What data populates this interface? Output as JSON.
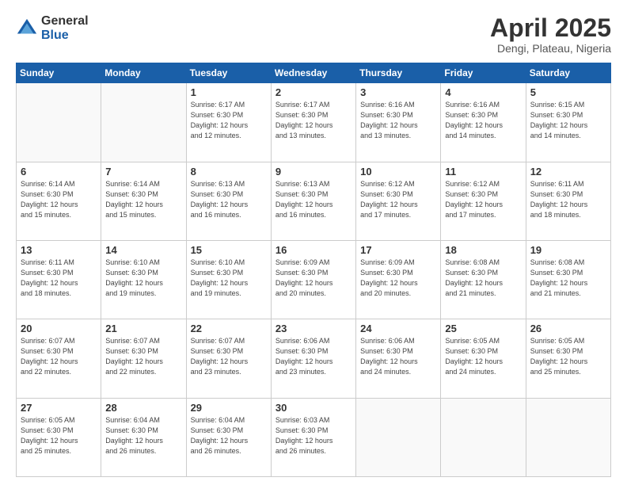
{
  "logo": {
    "general": "General",
    "blue": "Blue"
  },
  "title": {
    "month": "April 2025",
    "location": "Dengi, Plateau, Nigeria"
  },
  "weekdays": [
    "Sunday",
    "Monday",
    "Tuesday",
    "Wednesday",
    "Thursday",
    "Friday",
    "Saturday"
  ],
  "days": [
    {
      "date": "",
      "info": ""
    },
    {
      "date": "",
      "info": ""
    },
    {
      "date": "1",
      "info": "Sunrise: 6:17 AM\nSunset: 6:30 PM\nDaylight: 12 hours\nand 12 minutes."
    },
    {
      "date": "2",
      "info": "Sunrise: 6:17 AM\nSunset: 6:30 PM\nDaylight: 12 hours\nand 13 minutes."
    },
    {
      "date": "3",
      "info": "Sunrise: 6:16 AM\nSunset: 6:30 PM\nDaylight: 12 hours\nand 13 minutes."
    },
    {
      "date": "4",
      "info": "Sunrise: 6:16 AM\nSunset: 6:30 PM\nDaylight: 12 hours\nand 14 minutes."
    },
    {
      "date": "5",
      "info": "Sunrise: 6:15 AM\nSunset: 6:30 PM\nDaylight: 12 hours\nand 14 minutes."
    },
    {
      "date": "6",
      "info": "Sunrise: 6:14 AM\nSunset: 6:30 PM\nDaylight: 12 hours\nand 15 minutes."
    },
    {
      "date": "7",
      "info": "Sunrise: 6:14 AM\nSunset: 6:30 PM\nDaylight: 12 hours\nand 15 minutes."
    },
    {
      "date": "8",
      "info": "Sunrise: 6:13 AM\nSunset: 6:30 PM\nDaylight: 12 hours\nand 16 minutes."
    },
    {
      "date": "9",
      "info": "Sunrise: 6:13 AM\nSunset: 6:30 PM\nDaylight: 12 hours\nand 16 minutes."
    },
    {
      "date": "10",
      "info": "Sunrise: 6:12 AM\nSunset: 6:30 PM\nDaylight: 12 hours\nand 17 minutes."
    },
    {
      "date": "11",
      "info": "Sunrise: 6:12 AM\nSunset: 6:30 PM\nDaylight: 12 hours\nand 17 minutes."
    },
    {
      "date": "12",
      "info": "Sunrise: 6:11 AM\nSunset: 6:30 PM\nDaylight: 12 hours\nand 18 minutes."
    },
    {
      "date": "13",
      "info": "Sunrise: 6:11 AM\nSunset: 6:30 PM\nDaylight: 12 hours\nand 18 minutes."
    },
    {
      "date": "14",
      "info": "Sunrise: 6:10 AM\nSunset: 6:30 PM\nDaylight: 12 hours\nand 19 minutes."
    },
    {
      "date": "15",
      "info": "Sunrise: 6:10 AM\nSunset: 6:30 PM\nDaylight: 12 hours\nand 19 minutes."
    },
    {
      "date": "16",
      "info": "Sunrise: 6:09 AM\nSunset: 6:30 PM\nDaylight: 12 hours\nand 20 minutes."
    },
    {
      "date": "17",
      "info": "Sunrise: 6:09 AM\nSunset: 6:30 PM\nDaylight: 12 hours\nand 20 minutes."
    },
    {
      "date": "18",
      "info": "Sunrise: 6:08 AM\nSunset: 6:30 PM\nDaylight: 12 hours\nand 21 minutes."
    },
    {
      "date": "19",
      "info": "Sunrise: 6:08 AM\nSunset: 6:30 PM\nDaylight: 12 hours\nand 21 minutes."
    },
    {
      "date": "20",
      "info": "Sunrise: 6:07 AM\nSunset: 6:30 PM\nDaylight: 12 hours\nand 22 minutes."
    },
    {
      "date": "21",
      "info": "Sunrise: 6:07 AM\nSunset: 6:30 PM\nDaylight: 12 hours\nand 22 minutes."
    },
    {
      "date": "22",
      "info": "Sunrise: 6:07 AM\nSunset: 6:30 PM\nDaylight: 12 hours\nand 23 minutes."
    },
    {
      "date": "23",
      "info": "Sunrise: 6:06 AM\nSunset: 6:30 PM\nDaylight: 12 hours\nand 23 minutes."
    },
    {
      "date": "24",
      "info": "Sunrise: 6:06 AM\nSunset: 6:30 PM\nDaylight: 12 hours\nand 24 minutes."
    },
    {
      "date": "25",
      "info": "Sunrise: 6:05 AM\nSunset: 6:30 PM\nDaylight: 12 hours\nand 24 minutes."
    },
    {
      "date": "26",
      "info": "Sunrise: 6:05 AM\nSunset: 6:30 PM\nDaylight: 12 hours\nand 25 minutes."
    },
    {
      "date": "27",
      "info": "Sunrise: 6:05 AM\nSunset: 6:30 PM\nDaylight: 12 hours\nand 25 minutes."
    },
    {
      "date": "28",
      "info": "Sunrise: 6:04 AM\nSunset: 6:30 PM\nDaylight: 12 hours\nand 26 minutes."
    },
    {
      "date": "29",
      "info": "Sunrise: 6:04 AM\nSunset: 6:30 PM\nDaylight: 12 hours\nand 26 minutes."
    },
    {
      "date": "30",
      "info": "Sunrise: 6:03 AM\nSunset: 6:30 PM\nDaylight: 12 hours\nand 26 minutes."
    },
    {
      "date": "",
      "info": ""
    },
    {
      "date": "",
      "info": ""
    },
    {
      "date": "",
      "info": ""
    }
  ]
}
